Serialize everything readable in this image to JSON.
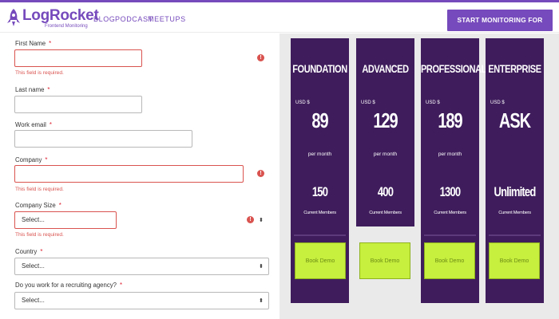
{
  "header": {
    "logo_name": "LogRocket",
    "logo_sub": "Frontend Monitoring",
    "nav": [
      "BLOG",
      "PODCAST",
      "MEETUPS"
    ],
    "cta_label": "START MONITORING FOR FREE",
    "brand_color": "#764abc"
  },
  "form": {
    "first_name": {
      "label": "First Name",
      "required": "*",
      "error": "This field is required.",
      "value": ""
    },
    "last_name": {
      "label": "Last name",
      "required": "*",
      "value": ""
    },
    "work_email": {
      "label": "Work email",
      "required": "*",
      "value": ""
    },
    "company": {
      "label": "Company",
      "required": "*",
      "error": "This field is required.",
      "value": ""
    },
    "company_size": {
      "label": "Company Size",
      "required": "*",
      "selected": "Select...",
      "error": "This field is required."
    },
    "country": {
      "label": "Country",
      "required": "*",
      "selected": "Select..."
    },
    "recruiting": {
      "label": "Do you work for a recruiting agency?",
      "required": "*",
      "selected": "Select..."
    },
    "error_icon": "!",
    "error_color": "#d9534f"
  },
  "pricing": {
    "card_color": "#3f1d5c",
    "button_color": "#c6ef3e",
    "plans": [
      {
        "name": "FOUNDATION",
        "currency": "USD $",
        "price": "89",
        "period": "per month",
        "members": "150",
        "members_label": "Current Members",
        "button": "Book Demo"
      },
      {
        "name": "ADVANCED",
        "currency": "USD $",
        "price": "129",
        "period": "per month",
        "members": "400",
        "members_label": "Current Members",
        "button": "Book Demo"
      },
      {
        "name": "PROFESSIONAL",
        "currency": "USD $",
        "price": "189",
        "period": "per month",
        "members": "1300",
        "members_label": "Current Members",
        "button": "Book Demo"
      },
      {
        "name": "ENTERPRISE",
        "currency": "USD $",
        "price": "ASK",
        "period": "",
        "members": "Unlimited",
        "members_label": "Current Members",
        "button": "Book Demo"
      }
    ]
  }
}
